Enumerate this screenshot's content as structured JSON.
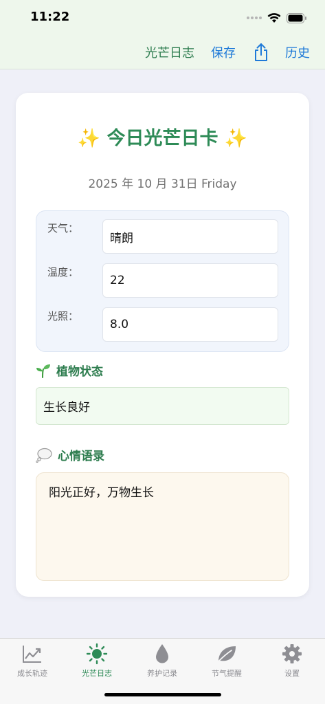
{
  "status_bar": {
    "time": "11:22"
  },
  "nav": {
    "title": "光芒日志",
    "save_label": "保存",
    "history_label": "历史"
  },
  "card": {
    "title": "✨ 今日光芒日卡 ✨",
    "date": "2025 年 10 月 31日 Friday",
    "weather": {
      "label": "天气：",
      "value": "晴朗"
    },
    "temperature": {
      "label": "温度：",
      "value": "22"
    },
    "light": {
      "label": "光照：",
      "value": "8.0"
    },
    "plant_section": {
      "title": "植物状态",
      "value": "生长良好"
    },
    "mood_section": {
      "title": "心情语录",
      "value": "阳光正好，万物生长"
    }
  },
  "tabs": [
    {
      "label": "成长轨迹",
      "icon": "chart-icon"
    },
    {
      "label": "光芒日志",
      "icon": "sun-icon",
      "active": true
    },
    {
      "label": "养护记录",
      "icon": "drop-icon"
    },
    {
      "label": "节气提醒",
      "icon": "leaf-icon"
    },
    {
      "label": "设置",
      "icon": "gear-icon"
    }
  ],
  "colors": {
    "accent_green": "#2e8b57",
    "link_blue": "#1f7ad8",
    "header_bg": "#eef7ec"
  }
}
